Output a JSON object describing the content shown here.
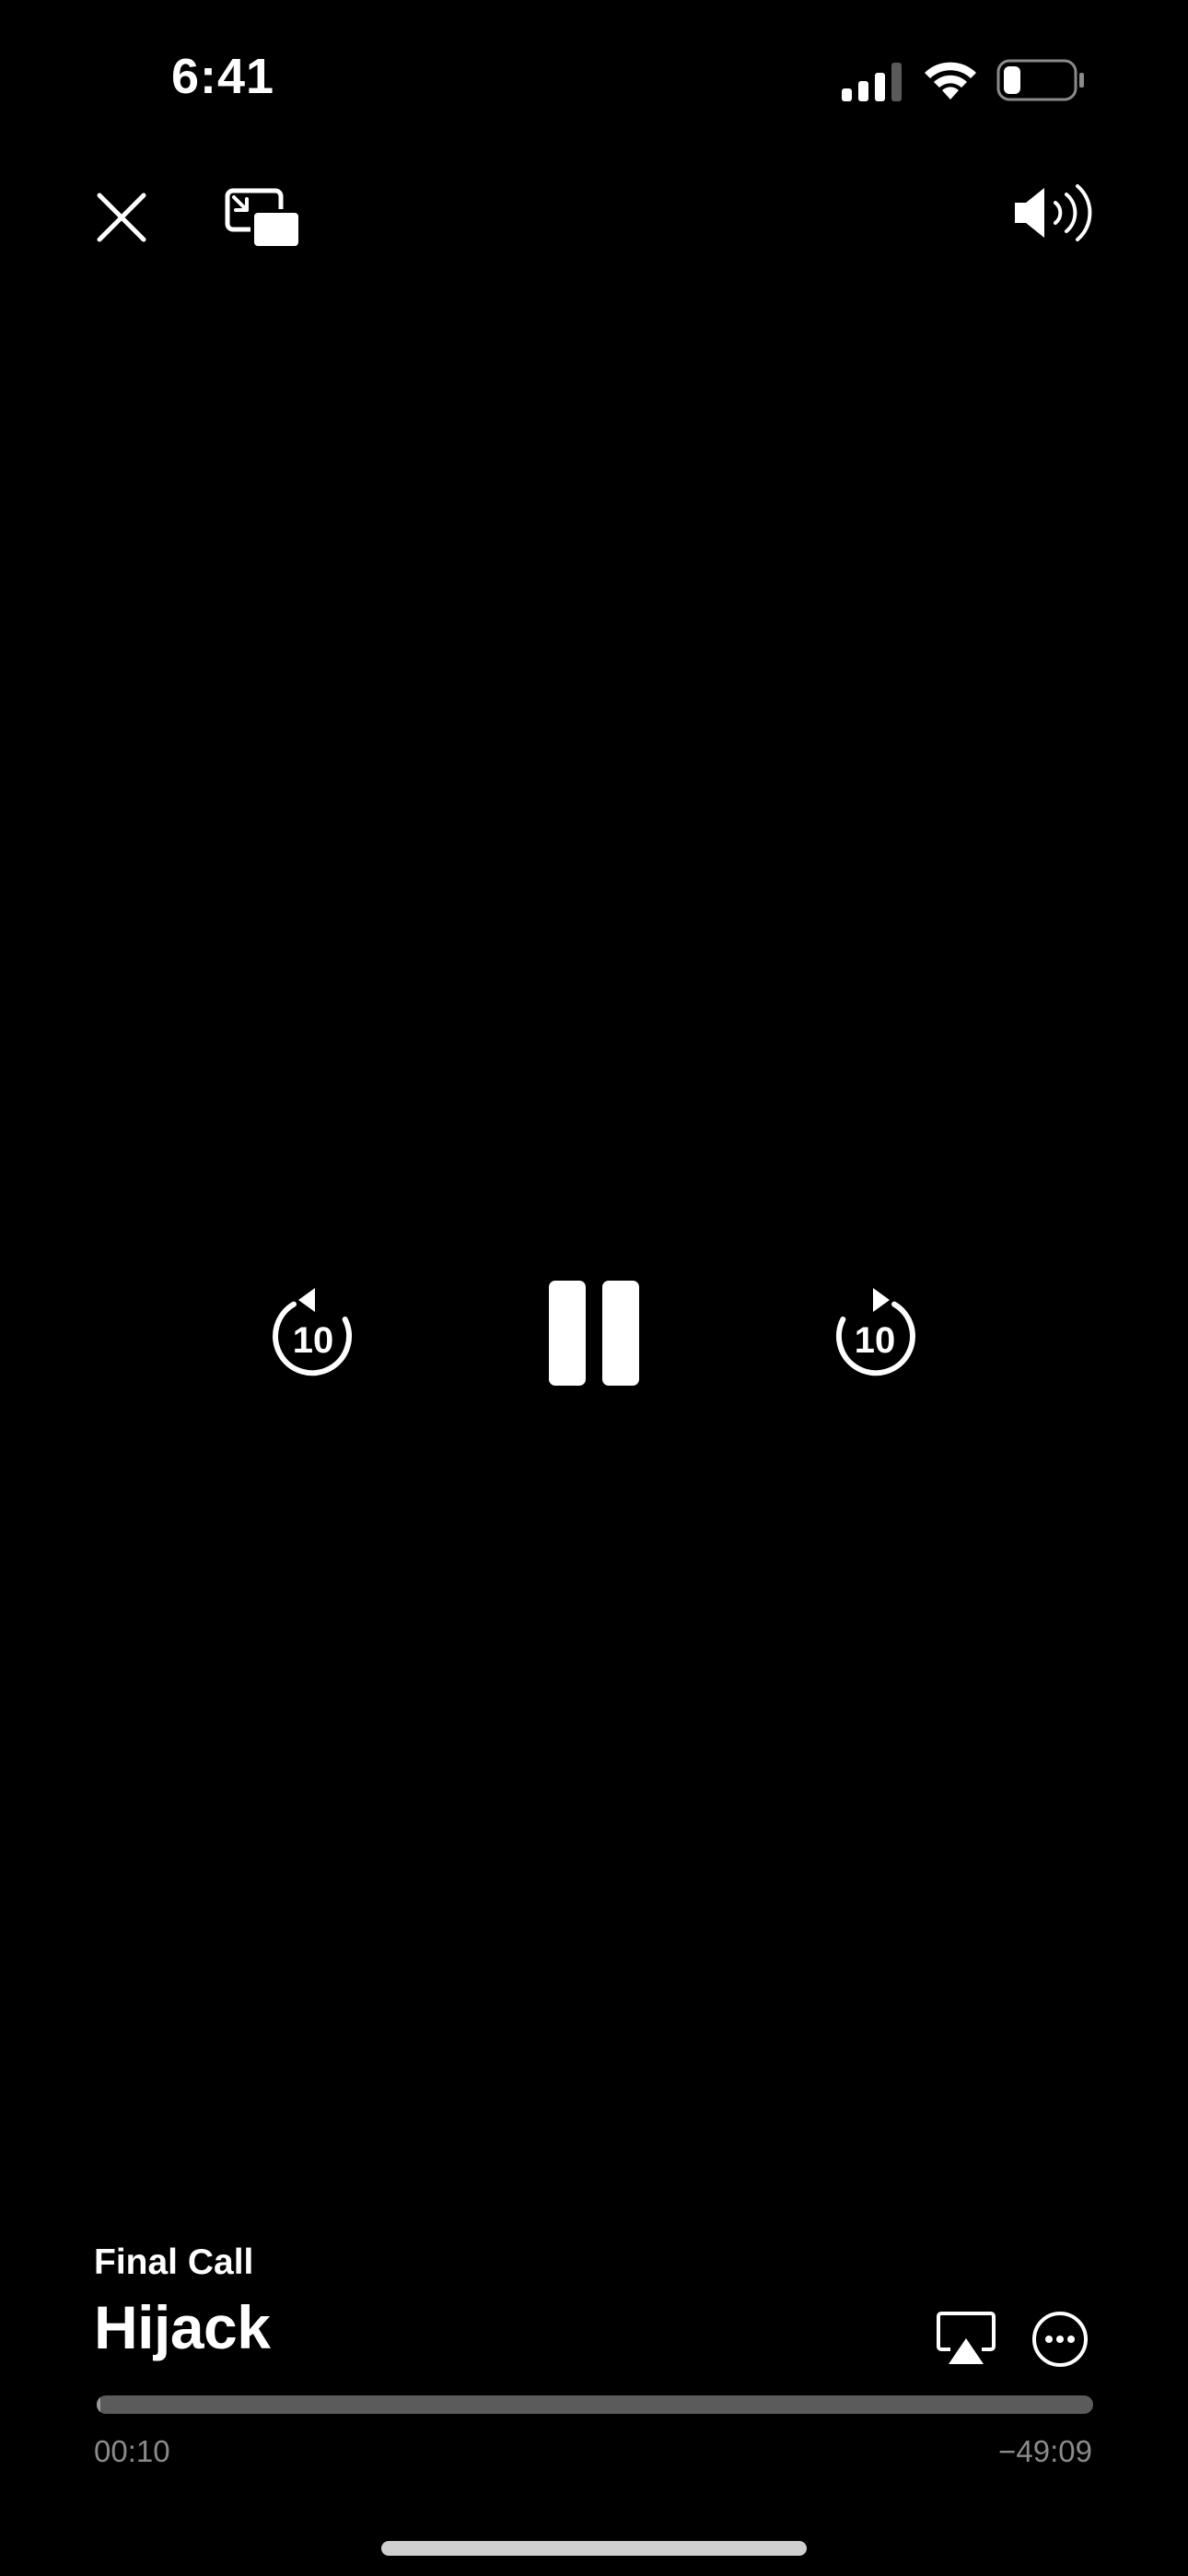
{
  "status_bar": {
    "time": "6:41",
    "signal_icon": "cellular-signal-icon",
    "wifi_icon": "wifi-icon",
    "battery_icon": "battery-icon",
    "battery_level": 0.25
  },
  "top_controls": {
    "close_icon": "close-icon",
    "pip_icon": "picture-in-picture-icon",
    "volume_icon": "speaker-volume-icon"
  },
  "playback_controls": {
    "skip_back_label": "10",
    "skip_forward_label": "10",
    "pause_icon": "pause-icon"
  },
  "now_playing": {
    "episode": "Final Call",
    "show": "Hijack",
    "airplay_icon": "airplay-icon",
    "more_icon": "more-options-icon"
  },
  "progress": {
    "elapsed": "00:10",
    "remaining": "−49:09",
    "fraction": 0.0034
  },
  "colors": {
    "background": "#000000",
    "foreground": "#ffffff",
    "track": "#5b5b5b",
    "muted_text": "#8a8a8a"
  }
}
